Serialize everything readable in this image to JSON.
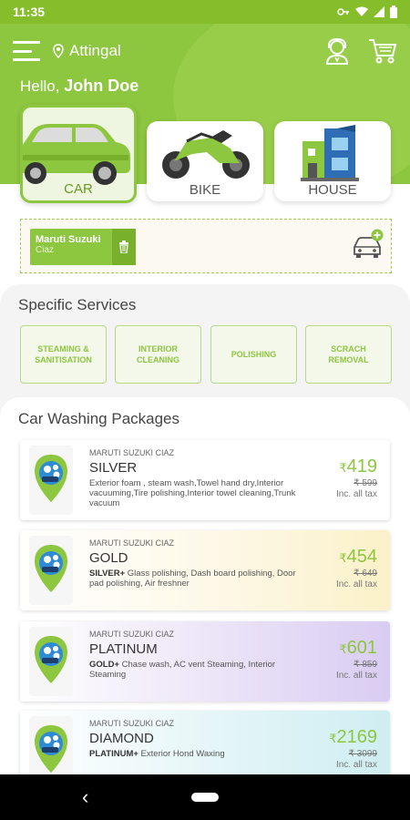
{
  "status": {
    "time": "11:35"
  },
  "header": {
    "location": "Attingal",
    "greeting_prefix": "Hello,",
    "user_name": "John Doe"
  },
  "tabs": [
    {
      "label": "CAR",
      "active": true
    },
    {
      "label": "BIKE",
      "active": false
    },
    {
      "label": "HOUSE",
      "active": false
    }
  ],
  "vehicle": {
    "make": "Maruti Suzuki",
    "model": "Ciaz"
  },
  "services": {
    "title": "Specific Services",
    "items": [
      "Steaming & Sanitisation",
      "Interior Cleaning",
      "Polishing",
      "Scrach Removal"
    ]
  },
  "packages": {
    "title": "Car Washing Packages",
    "items": [
      {
        "car": "Maruti Suzuki Ciaz",
        "name": "SILVER",
        "prefix": "",
        "desc": "Exterior foam , steam wash,Towel hand dry,Interior vacuuming,Tire polishing,Interior towel cleaning,Trunk vacuum",
        "currency": "₹",
        "price": "419",
        "mrp": "₹ 599",
        "tax": "Inc. all tax",
        "bg": "#ffffff"
      },
      {
        "car": "Maruti Suzuki Ciaz",
        "name": "GOLD",
        "prefix": "SILVER+",
        "desc": " Glass polishing, Dash board polishing, Door pad polishing, Air freshner",
        "currency": "₹",
        "price": "454",
        "mrp": "₹ 649",
        "tax": "Inc. all tax",
        "bg": "linear-gradient(90deg,#ffffff 0%,#fdf8e6 55%,#fbf1c9 100%)"
      },
      {
        "car": "Maruti Suzuki Ciaz",
        "name": "PLATINUM",
        "prefix": "GOLD+",
        "desc": " Chase wash, AC vent Steaming, Interior Steaming",
        "currency": "₹",
        "price": "601",
        "mrp": "₹ 859",
        "tax": "Inc. all tax",
        "bg": "linear-gradient(90deg,#ffffff 0%,#ede6f8 50%,#d9ccf2 100%)"
      },
      {
        "car": "Maruti Suzuki Ciaz",
        "name": "DIAMOND",
        "prefix": "PLATINUM+",
        "desc": " Exterior Hond Waxing",
        "currency": "₹",
        "price": "2169",
        "mrp": "₹ 3099",
        "tax": "Inc. all tax",
        "bg": "linear-gradient(90deg,#ffffff 0%,#e6f6f8 50%,#cfeef2 100%)"
      }
    ]
  },
  "colors": {
    "brand": "#8dc63f",
    "price": "#8dc63f"
  }
}
